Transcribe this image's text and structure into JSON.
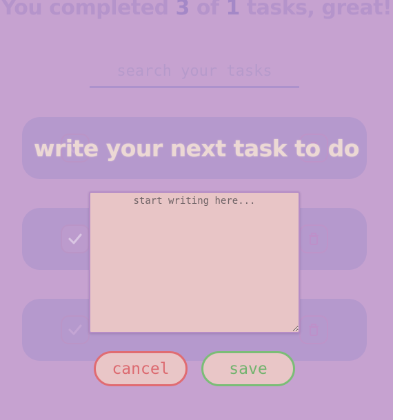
{
  "summary": {
    "prefix": "You completed ",
    "completed": "3",
    "of_label": " of ",
    "total": "1",
    "suffix": " tasks, great!"
  },
  "search": {
    "placeholder": "search your tasks"
  },
  "tasks": [
    {
      "done": false
    },
    {
      "done": true
    },
    {
      "done": false
    }
  ],
  "modal": {
    "title": "write your next task to do",
    "textarea_placeholder": "start writing here...",
    "cancel_label": "cancel",
    "save_label": "save"
  },
  "colors": {
    "background": "#c6a2d0",
    "task_card": "#a892cc",
    "textarea_bg": "#e8c5c6",
    "cancel": "#e06c72",
    "save": "#7bbd77"
  },
  "icons": {
    "check": "check-icon",
    "delete": "trash-icon"
  }
}
